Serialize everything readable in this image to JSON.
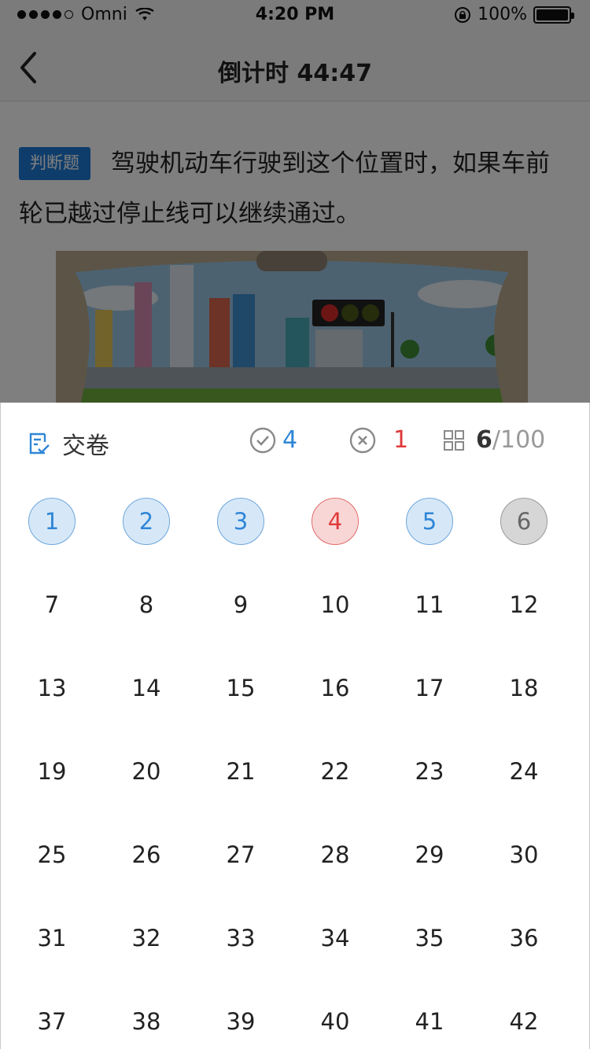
{
  "status_bar": {
    "carrier": "Omni",
    "time": "4:20 PM",
    "battery": "100%"
  },
  "nav": {
    "title": "倒计时 44:47"
  },
  "question": {
    "tag": "判断题",
    "text": "驾驶机动车行驶到这个位置时，如果车前轮已越过停止线可以继续通过。"
  },
  "sheet": {
    "submit_label": "交卷",
    "correct_count": "4",
    "wrong_count": "1",
    "current": "6",
    "separator": "/",
    "total": "100"
  },
  "questions": [
    {
      "n": "1",
      "status": "correct"
    },
    {
      "n": "2",
      "status": "correct"
    },
    {
      "n": "3",
      "status": "correct"
    },
    {
      "n": "4",
      "status": "wrong"
    },
    {
      "n": "5",
      "status": "correct"
    },
    {
      "n": "6",
      "status": "current"
    },
    {
      "n": "7",
      "status": "unanswered"
    },
    {
      "n": "8",
      "status": "unanswered"
    },
    {
      "n": "9",
      "status": "unanswered"
    },
    {
      "n": "10",
      "status": "unanswered"
    },
    {
      "n": "11",
      "status": "unanswered"
    },
    {
      "n": "12",
      "status": "unanswered"
    },
    {
      "n": "13",
      "status": "unanswered"
    },
    {
      "n": "14",
      "status": "unanswered"
    },
    {
      "n": "15",
      "status": "unanswered"
    },
    {
      "n": "16",
      "status": "unanswered"
    },
    {
      "n": "17",
      "status": "unanswered"
    },
    {
      "n": "18",
      "status": "unanswered"
    },
    {
      "n": "19",
      "status": "unanswered"
    },
    {
      "n": "20",
      "status": "unanswered"
    },
    {
      "n": "21",
      "status": "unanswered"
    },
    {
      "n": "22",
      "status": "unanswered"
    },
    {
      "n": "23",
      "status": "unanswered"
    },
    {
      "n": "24",
      "status": "unanswered"
    },
    {
      "n": "25",
      "status": "unanswered"
    },
    {
      "n": "26",
      "status": "unanswered"
    },
    {
      "n": "27",
      "status": "unanswered"
    },
    {
      "n": "28",
      "status": "unanswered"
    },
    {
      "n": "29",
      "status": "unanswered"
    },
    {
      "n": "30",
      "status": "unanswered"
    },
    {
      "n": "31",
      "status": "unanswered"
    },
    {
      "n": "32",
      "status": "unanswered"
    },
    {
      "n": "33",
      "status": "unanswered"
    },
    {
      "n": "34",
      "status": "unanswered"
    },
    {
      "n": "35",
      "status": "unanswered"
    },
    {
      "n": "36",
      "status": "unanswered"
    },
    {
      "n": "37",
      "status": "unanswered"
    },
    {
      "n": "38",
      "status": "unanswered"
    },
    {
      "n": "39",
      "status": "unanswered"
    },
    {
      "n": "40",
      "status": "unanswered"
    },
    {
      "n": "41",
      "status": "unanswered"
    },
    {
      "n": "42",
      "status": "unanswered"
    }
  ],
  "colors": {
    "accent_blue": "#2f86d6",
    "error_red": "#e03a3a",
    "tag_blue": "#1f7bd6"
  },
  "icons": {
    "back": "chevron-left-icon",
    "submit": "answer-sheet-icon",
    "correct": "check-circle-icon",
    "wrong": "x-circle-icon",
    "progress": "grid-icon"
  }
}
